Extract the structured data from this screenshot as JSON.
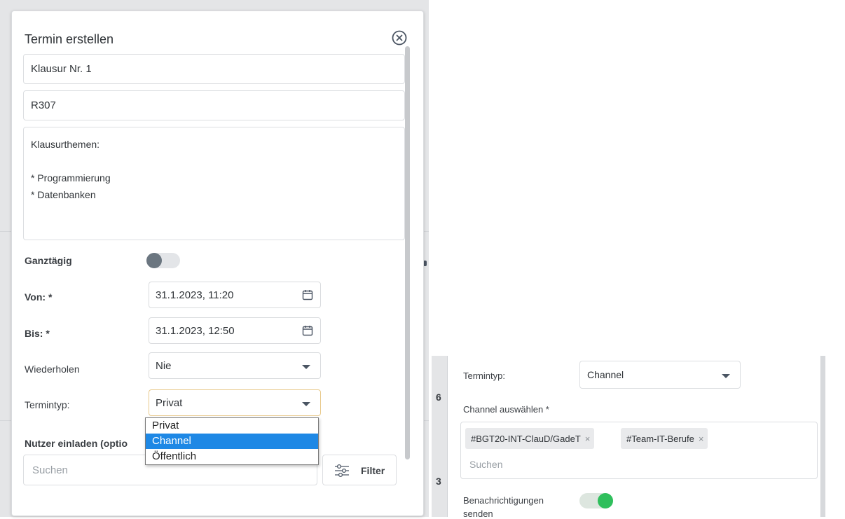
{
  "modal": {
    "title": "Termin erstellen",
    "fields": {
      "title_value": "Klausur Nr. 1",
      "location_value": "R307",
      "description_value": "Klausurthemen:\n\n* Programmierung\n* Datenbanken"
    },
    "all_day": {
      "label": "Ganztägig",
      "enabled": false
    },
    "from": {
      "label": "Von: *",
      "value": "31.1.2023, 11:20"
    },
    "to": {
      "label": "Bis: *",
      "value": "31.1.2023, 12:50"
    },
    "repeat": {
      "label": "Wiederholen",
      "value": "Nie"
    },
    "type": {
      "label": "Termintyp:",
      "value": "Privat",
      "options": [
        "Privat",
        "Channel",
        "Öffentlich"
      ],
      "highlighted_option": "Channel"
    },
    "invite": {
      "label": "Nutzer einladen (optio",
      "search_placeholder": "Suchen",
      "filter_label": "Filter"
    }
  },
  "right_panel": {
    "side_numbers": [
      "6",
      "3"
    ],
    "type": {
      "label": "Termintyp:",
      "value": "Channel"
    },
    "channel": {
      "label": "Channel auswählen *",
      "tags": [
        "#BGT20-INT-ClauD/GadeT",
        "#Team-IT-Berufe"
      ],
      "tag_remove_symbol": "×",
      "search_placeholder": "Suchen"
    },
    "notifications": {
      "label_line1": "Benachrichtigungen",
      "label_line2": "senden",
      "enabled": true
    }
  },
  "colors": {
    "accent_selected": "#1e88e5",
    "toggle_on": "#2fbf5c",
    "toggle_off_knob": "#6b7680",
    "focus_border": "#e8c98a"
  }
}
